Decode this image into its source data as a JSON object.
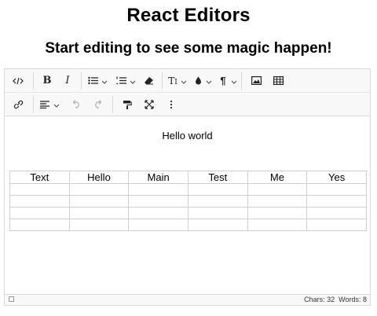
{
  "page": {
    "title": "React Editors",
    "subtitle": "Start editing to see some magic happen!"
  },
  "toolbar": {
    "row1": [
      {
        "name": "source-code-icon",
        "group": 1
      },
      {
        "name": "bold-icon",
        "group": 2
      },
      {
        "name": "italic-icon",
        "group": 2
      },
      {
        "name": "bulleted-list-icon",
        "group": 3,
        "dropdown": true
      },
      {
        "name": "numbered-list-icon",
        "group": 3,
        "dropdown": true
      },
      {
        "name": "eraser-icon",
        "group": 3
      },
      {
        "name": "font-size-icon",
        "group": 4,
        "dropdown": true
      },
      {
        "name": "text-color-icon",
        "group": 4,
        "dropdown": true
      },
      {
        "name": "paragraph-icon",
        "group": 4,
        "dropdown": true
      },
      {
        "name": "image-icon",
        "group": 5
      },
      {
        "name": "table-icon",
        "group": 5
      }
    ],
    "row2": [
      {
        "name": "link-icon",
        "group": 1
      },
      {
        "name": "align-icon",
        "group": 2,
        "dropdown": true
      },
      {
        "name": "undo-icon",
        "group": 2,
        "disabled": true
      },
      {
        "name": "redo-icon",
        "group": 2,
        "disabled": true
      },
      {
        "name": "format-painter-icon",
        "group": 3
      },
      {
        "name": "fullscreen-icon",
        "group": 3
      },
      {
        "name": "more-icon",
        "group": 3
      }
    ]
  },
  "content": {
    "paragraph": "Hello world",
    "table": {
      "headers": [
        "Text",
        "Hello",
        "Main",
        "Test",
        "Me",
        "Yes"
      ],
      "empty_rows": 4
    }
  },
  "status": {
    "chars_label": "Chars: 32",
    "words_label": "Words: 8"
  }
}
